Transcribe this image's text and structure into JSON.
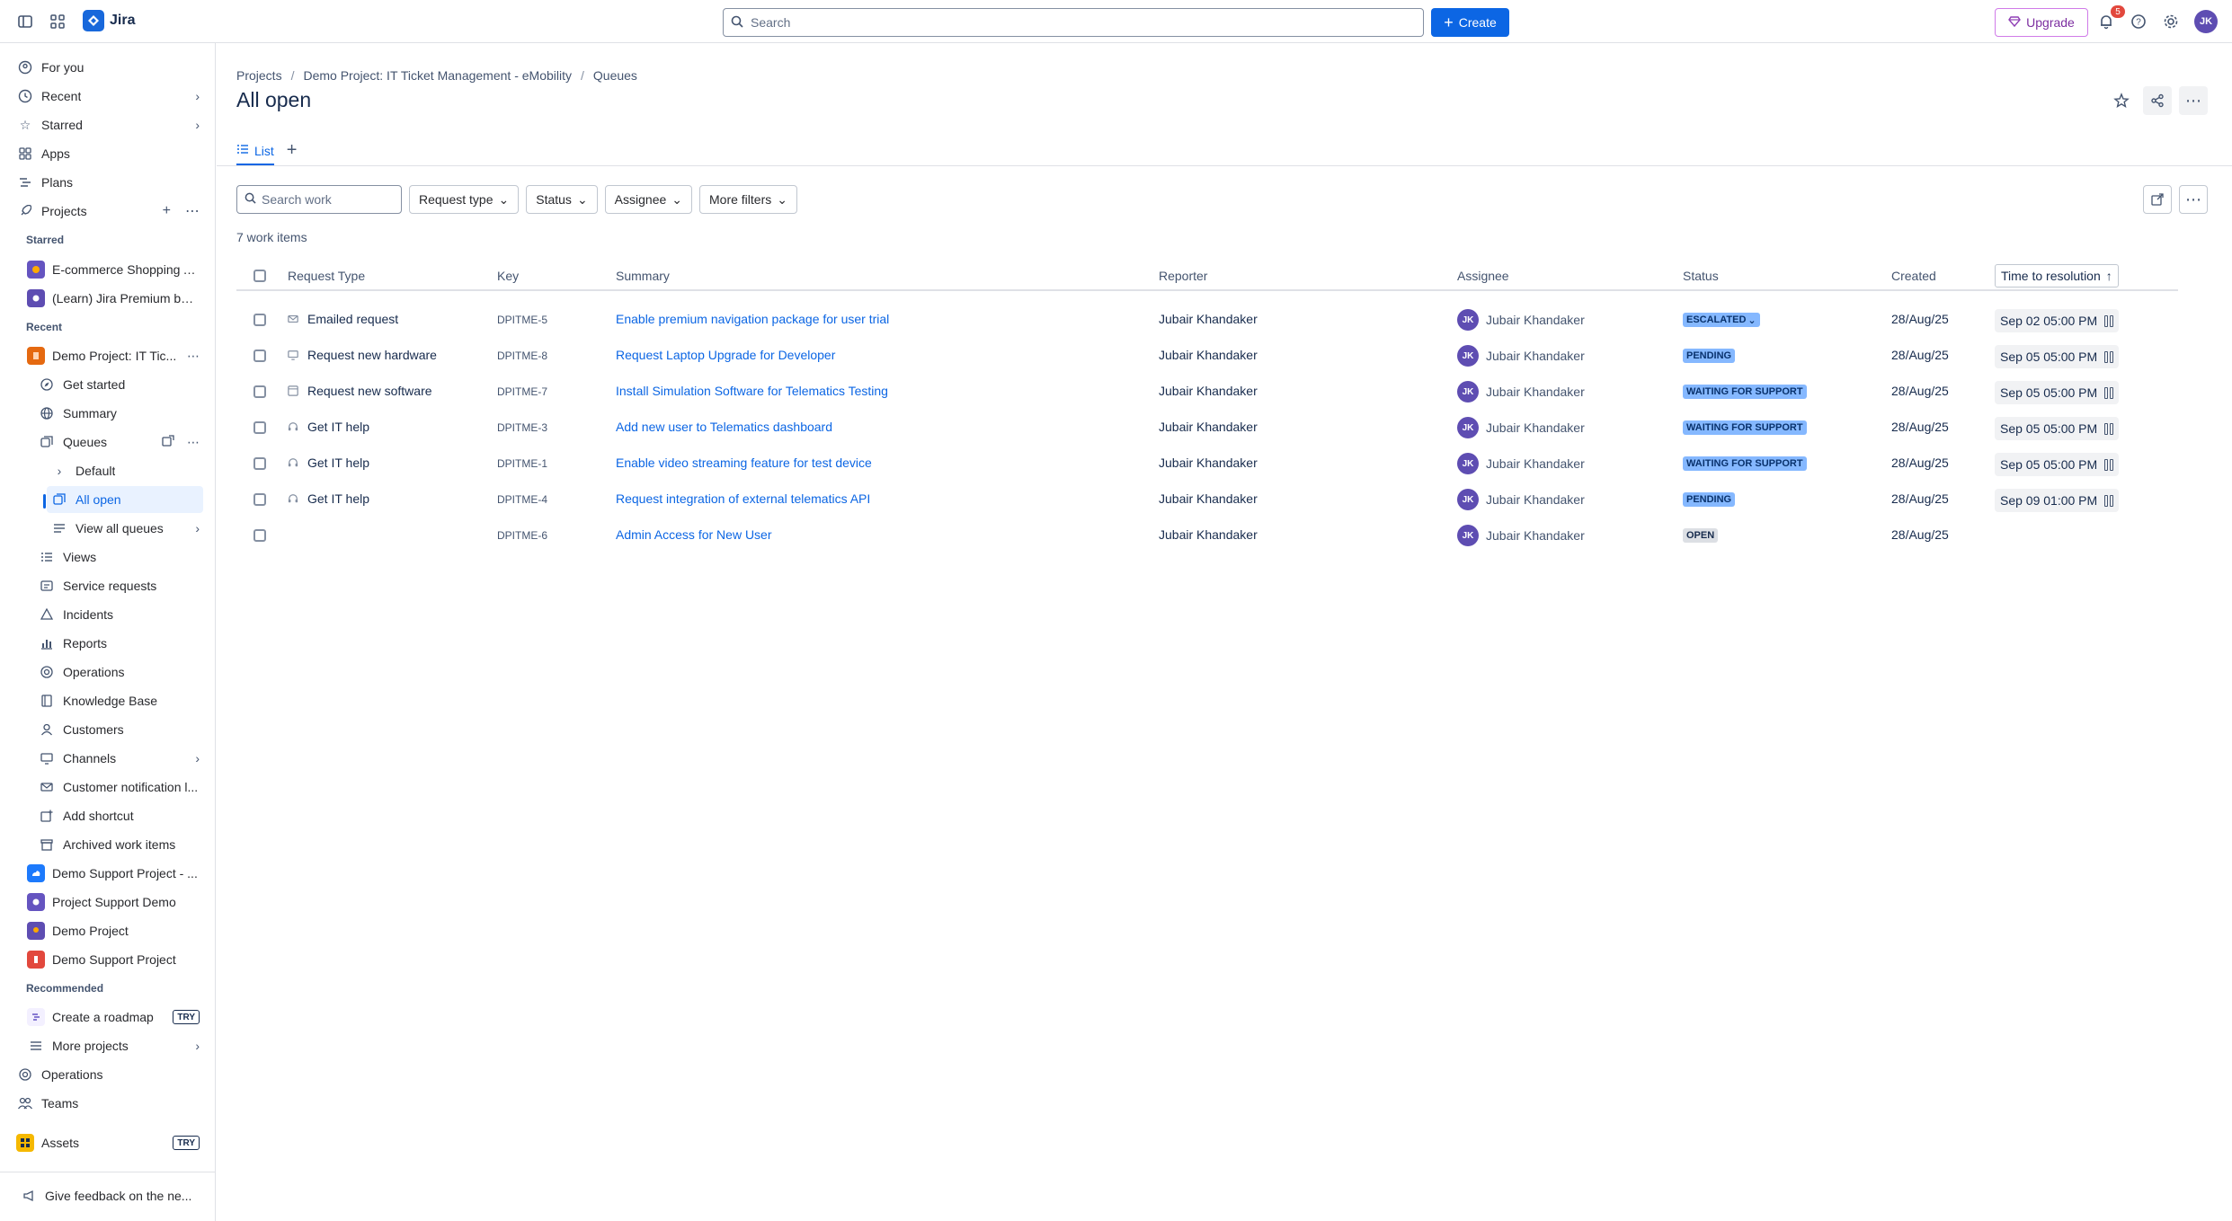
{
  "topbar": {
    "app_name": "Jira",
    "search_placeholder": "Search",
    "create_label": "Create",
    "upgrade_label": "Upgrade",
    "notification_count": "5",
    "avatar_initials": "JK"
  },
  "sidebar": {
    "top_items": [
      {
        "label": "For you",
        "icon": "user-circle-icon"
      },
      {
        "label": "Recent",
        "icon": "clock-icon"
      },
      {
        "label": "Starred",
        "icon": "star-icon"
      },
      {
        "label": "Apps",
        "icon": "apps-icon"
      },
      {
        "label": "Plans",
        "icon": "plans-icon"
      },
      {
        "label": "Projects",
        "icon": "rocket-icon"
      }
    ],
    "starred_heading": "Starred",
    "starred": [
      {
        "label": "E-commerce Shopping A...",
        "color": "#6554c0"
      },
      {
        "label": "(Learn) Jira Premium ben...",
        "color": "#5e4db2"
      }
    ],
    "recent_heading": "Recent",
    "current_project": "Demo Project: IT Tic...",
    "project_children": [
      {
        "label": "Get started",
        "icon": "compass-icon"
      },
      {
        "label": "Summary",
        "icon": "globe-icon"
      },
      {
        "label": "Queues",
        "icon": "queues-icon"
      },
      {
        "label": "Default",
        "icon": "chevron-right-icon"
      },
      {
        "label": "All open",
        "icon": "queue-icon"
      },
      {
        "label": "View all queues",
        "icon": "list-icon"
      },
      {
        "label": "Views",
        "icon": "list-icon"
      },
      {
        "label": "Service requests",
        "icon": "request-icon"
      },
      {
        "label": "Incidents",
        "icon": "alert-icon"
      },
      {
        "label": "Reports",
        "icon": "chart-icon"
      },
      {
        "label": "Operations",
        "icon": "operations-icon"
      },
      {
        "label": "Knowledge Base",
        "icon": "book-icon"
      },
      {
        "label": "Customers",
        "icon": "person-icon"
      },
      {
        "label": "Channels",
        "icon": "monitor-icon"
      },
      {
        "label": "Customer notification l...",
        "icon": "mail-icon"
      },
      {
        "label": "Add shortcut",
        "icon": "add-shortcut-icon"
      },
      {
        "label": "Archived work items",
        "icon": "archive-icon"
      }
    ],
    "other_projects": [
      {
        "label": "Demo Support Project - ...",
        "color": "#1d7afc"
      },
      {
        "label": "Project Support Demo",
        "color": "#6554c0"
      },
      {
        "label": "Demo Project",
        "color": "#5e4db2"
      },
      {
        "label": "Demo Support Project",
        "color": "#e2483d"
      }
    ],
    "recommended_heading": "Recommended",
    "create_roadmap": "Create a roadmap",
    "try_label": "TRY",
    "more_projects": "More projects",
    "operations": "Operations",
    "teams": "Teams",
    "assets": "Assets",
    "feedback": "Give feedback on the ne..."
  },
  "breadcrumbs": [
    "Projects",
    "Demo Project: IT Ticket Management - eMobility",
    "Queues"
  ],
  "page_title": "All open",
  "tabs": {
    "list_label": "List"
  },
  "filters": {
    "search_placeholder": "Search work",
    "buttons": [
      "Request type",
      "Status",
      "Assignee",
      "More filters"
    ]
  },
  "count_label": "7 work items",
  "columns": [
    "Request Type",
    "Key",
    "Summary",
    "Reporter",
    "Assignee",
    "Status",
    "Created",
    "Time to resolution"
  ],
  "rows": [
    {
      "request_type": "Emailed request",
      "icon": "mail-icon",
      "key": "DPITME-5",
      "summary": "Enable premium navigation package for user trial",
      "reporter": "Jubair Khandaker",
      "assignee": "Jubair Khandaker",
      "status": "ESCALATED",
      "created": "28/Aug/25",
      "ttr": "Sep 02 05:00 PM"
    },
    {
      "request_type": "Request new hardware",
      "icon": "hardware-icon",
      "key": "DPITME-8",
      "summary": "Request Laptop Upgrade for Developer",
      "reporter": "Jubair Khandaker",
      "assignee": "Jubair Khandaker",
      "status": "PENDING",
      "created": "28/Aug/25",
      "ttr": "Sep 05 05:00 PM"
    },
    {
      "request_type": "Request new software",
      "icon": "software-icon",
      "key": "DPITME-7",
      "summary": "Install Simulation Software for Telematics Testing",
      "reporter": "Jubair Khandaker",
      "assignee": "Jubair Khandaker",
      "status": "WAITING FOR SUPPORT",
      "created": "28/Aug/25",
      "ttr": "Sep 05 05:00 PM"
    },
    {
      "request_type": "Get IT help",
      "icon": "headset-icon",
      "key": "DPITME-3",
      "summary": "Add new user to Telematics dashboard",
      "reporter": "Jubair Khandaker",
      "assignee": "Jubair Khandaker",
      "status": "WAITING FOR SUPPORT",
      "created": "28/Aug/25",
      "ttr": "Sep 05 05:00 PM"
    },
    {
      "request_type": "Get IT help",
      "icon": "headset-icon",
      "key": "DPITME-1",
      "summary": "Enable video streaming feature for test device",
      "reporter": "Jubair Khandaker",
      "assignee": "Jubair Khandaker",
      "status": "WAITING FOR SUPPORT",
      "created": "28/Aug/25",
      "ttr": "Sep 05 05:00 PM"
    },
    {
      "request_type": "Get IT help",
      "icon": "headset-icon",
      "key": "DPITME-4",
      "summary": "Request integration of external telematics API",
      "reporter": "Jubair Khandaker",
      "assignee": "Jubair Khandaker",
      "status": "PENDING",
      "created": "28/Aug/25",
      "ttr": "Sep 09 01:00 PM"
    },
    {
      "request_type": "",
      "icon": "",
      "key": "DPITME-6",
      "summary": "Admin Access for New User",
      "reporter": "Jubair Khandaker",
      "assignee": "Jubair Khandaker",
      "status": "OPEN",
      "created": "28/Aug/25",
      "ttr": ""
    }
  ],
  "assignee_initials": "JK",
  "colors": {
    "accent": "#0c66e4",
    "status_blue": "#85b8ff",
    "status_gray": "#dcdfe4"
  }
}
